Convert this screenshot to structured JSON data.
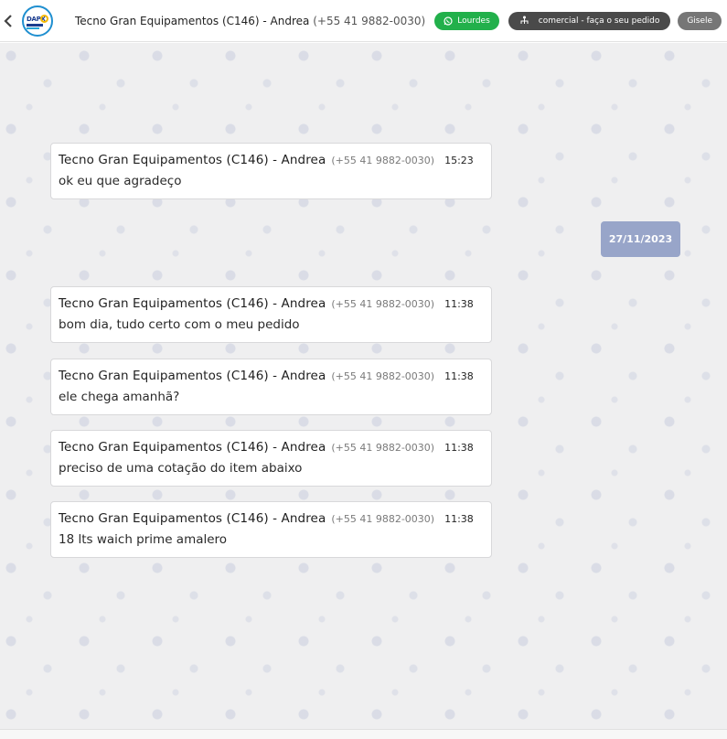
{
  "header": {
    "contact_name": "Tecno Gran Equipamentos (C146) - Andrea",
    "contact_phone": "(+55 41 9882-0030)",
    "logo_text": "DAPX",
    "tags": [
      {
        "label": "Lourdes",
        "icon": "whatsapp-icon"
      },
      {
        "label": "comercial - faça o seu pedido",
        "icon": "sitemap-icon"
      },
      {
        "label": "Gisele"
      }
    ]
  },
  "chat": {
    "date_separator": "27/11/2023",
    "messages": [
      {
        "sender": "Tecno Gran Equipamentos (C146) - Andrea",
        "phone": "(+55 41 9882-0030)",
        "time": "15:23",
        "text": "ok eu que agradeço"
      },
      {
        "sender": "Tecno Gran Equipamentos (C146) - Andrea",
        "phone": "(+55 41 9882-0030)",
        "time": "11:38",
        "text": "bom dia, tudo certo com o meu pedido"
      },
      {
        "sender": "Tecno Gran Equipamentos (C146) - Andrea",
        "phone": "(+55 41 9882-0030)",
        "time": "11:38",
        "text": "ele chega amanhã?"
      },
      {
        "sender": "Tecno Gran Equipamentos (C146) - Andrea",
        "phone": "(+55 41 9882-0030)",
        "time": "11:38",
        "text": "preciso de uma cotação do item abaixo"
      },
      {
        "sender": "Tecno Gran Equipamentos (C146) - Andrea",
        "phone": "(+55 41 9882-0030)",
        "time": "11:38",
        "text": "18 lts waich prime amalero"
      }
    ]
  },
  "colors": {
    "tag_green": "#22b04b",
    "tag_dark": "#4a4a4a",
    "tag_gray": "#767676",
    "date_chip": "#98a5c9",
    "chat_bg": "#efeff0"
  }
}
